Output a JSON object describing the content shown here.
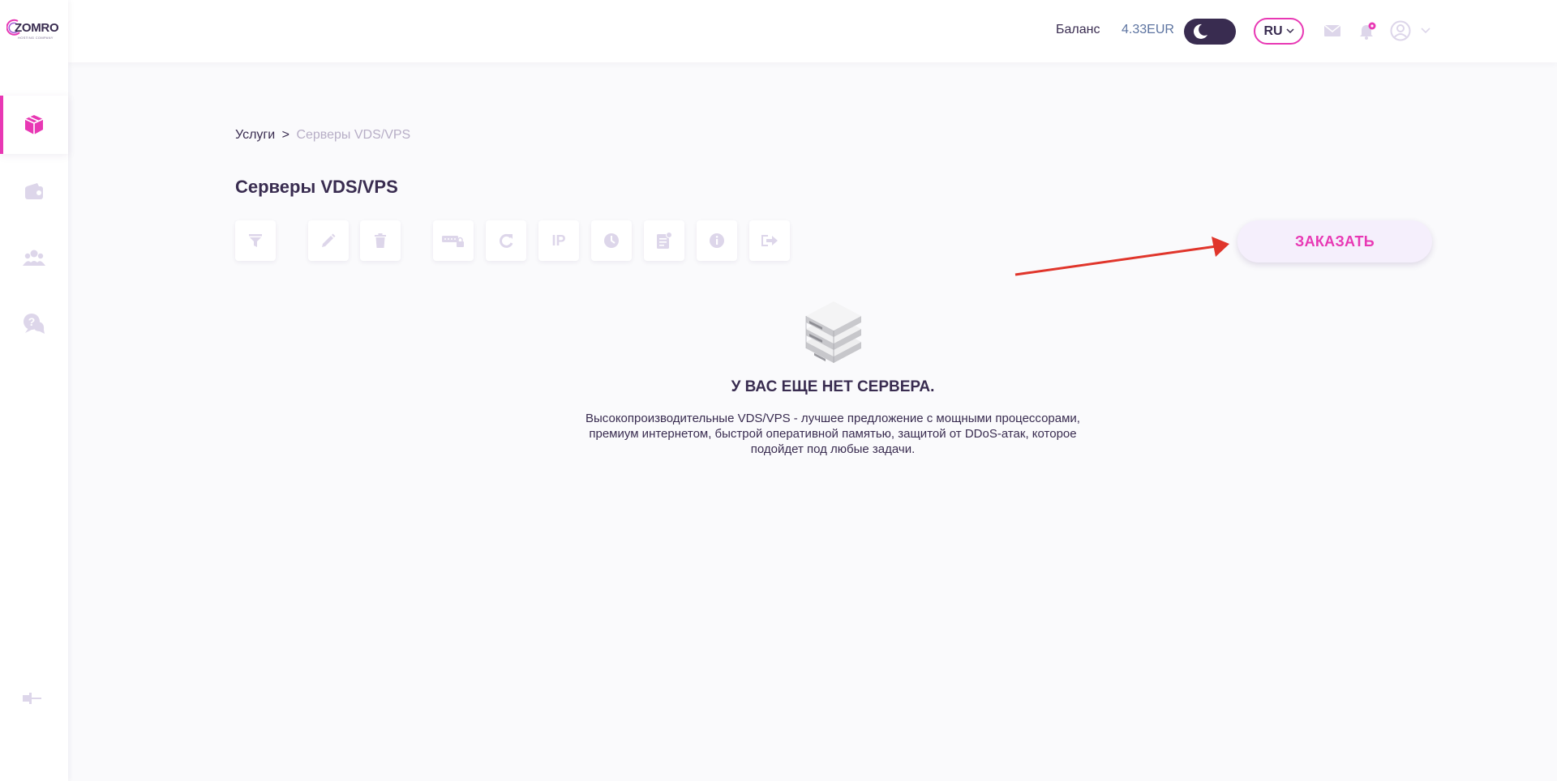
{
  "colors": {
    "brand_pink": "#e838b4",
    "text_dark": "#392c50",
    "icon_muted": "#ddd6ea",
    "balance_value": "#5c73a0",
    "arrow_red": "#e0352b"
  },
  "logo": {
    "name": "ZOMRO",
    "tagline": "HOSTING COMPANY"
  },
  "sidebar": {
    "items": [
      {
        "icon": "box-icon",
        "active": true
      },
      {
        "icon": "wallet-icon",
        "active": false
      },
      {
        "icon": "users-icon",
        "active": false
      },
      {
        "icon": "support-chat-icon",
        "active": false
      }
    ],
    "collapse_icon": "collapse-sidebar-icon"
  },
  "header": {
    "balance_label": "Баланс",
    "balance_value": "4.33EUR",
    "theme_toggle": "dark",
    "language": "RU",
    "icons": [
      "mail-icon",
      "bell-icon",
      "user-avatar-icon",
      "chevron-down-icon"
    ]
  },
  "breadcrumb": {
    "root": "Услуги",
    "separator": ">",
    "current": "Серверы VDS/VPS"
  },
  "page_title": "Серверы VDS/VPS",
  "toolbar": {
    "ip_label": "IP",
    "buttons": [
      "filter-icon",
      "edit-icon",
      "delete-icon",
      "password-icon",
      "reload-icon",
      "ip-icon",
      "history-icon",
      "instruction-icon",
      "info-icon",
      "login-icon"
    ],
    "order_label": "ЗАКАЗАТЬ"
  },
  "empty_state": {
    "title": "У ВАС ЕЩЕ НЕТ СЕРВЕРА.",
    "description": "Высокопроизводительные VDS/VPS - лучшее предложение с мощными процессорами, премиум интернетом, быстрой оперативной памятью, защитой от DDoS-атак, которое подойдет под любые задачи."
  }
}
